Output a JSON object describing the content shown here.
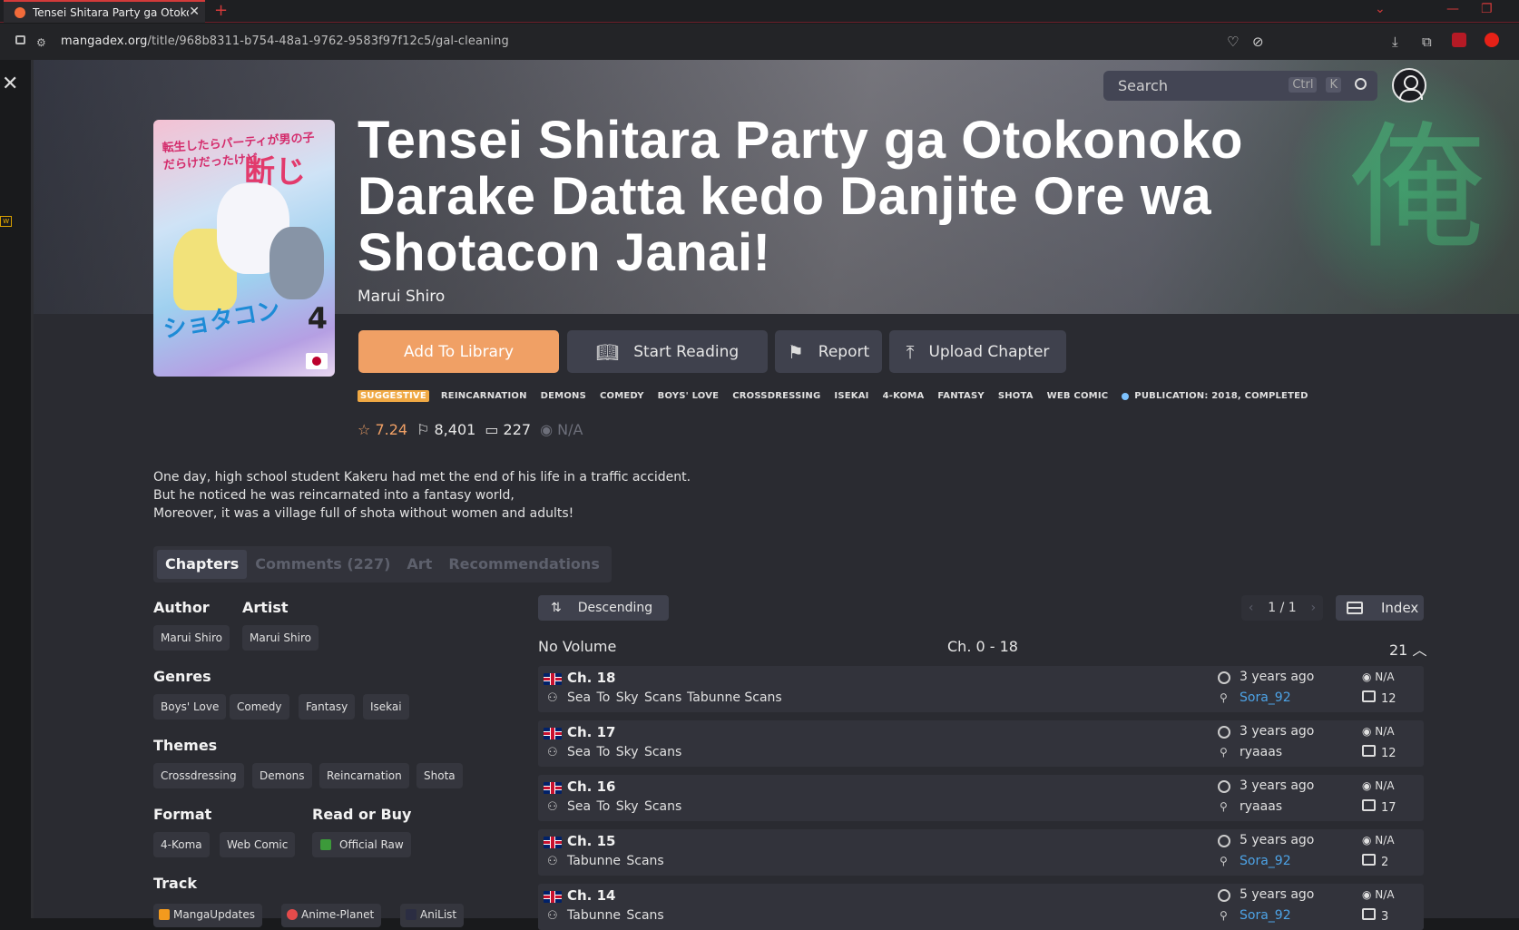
{
  "browser": {
    "tab_title": "Tensei Shitara Party ga Otokonoko",
    "url_host": "mangadex.org",
    "url_path": "/title/968b8311-b754-48a1-9762-9583f97f12c5/gal-cleaning"
  },
  "header": {
    "search_placeholder": "Search",
    "kbd_ctrl": "Ctrl",
    "kbd_k": "K"
  },
  "manga": {
    "title": "Tensei Shitara Party ga Otokonoko Darake Datta kedo Danjite Ore wa Shotacon Janai!",
    "author": "Marui Shiro",
    "buttons": {
      "add": "Add To Library",
      "start": "Start Reading",
      "report": "Report",
      "upload": "Upload Chapter"
    },
    "tags": {
      "suggestive": "SUGGESTIVE",
      "list": [
        "REINCARNATION",
        "DEMONS",
        "COMEDY",
        "BOYS' LOVE",
        "CROSSDRESSING",
        "ISEKAI",
        "4-KOMA",
        "FANTASY",
        "SHOTA",
        "WEB COMIC"
      ],
      "publication": "PUBLICATION: 2018, COMPLETED"
    },
    "stats": {
      "rating": "7.24",
      "follows": "8,401",
      "comments": "227",
      "views": "N/A"
    },
    "description": [
      "One day, high school student Kakeru had met the end of his life in a traffic accident.",
      "But he noticed he was reincarnated into a fantasy world,",
      "Moreover, it was a village full of shota without women and adults!"
    ]
  },
  "tabs": {
    "chapters": "Chapters",
    "comments": "Comments (227)",
    "art": "Art",
    "recommendations": "Recommendations"
  },
  "info": {
    "author_h": "Author",
    "artist_h": "Artist",
    "author": "Marui Shiro",
    "artist": "Marui Shiro",
    "genres_h": "Genres",
    "genres": [
      "Boys' Love",
      "Comedy",
      "Fantasy",
      "Isekai"
    ],
    "themes_h": "Themes",
    "themes": [
      "Crossdressing",
      "Demons",
      "Reincarnation",
      "Shota"
    ],
    "format_h": "Format",
    "format": [
      "4-Koma",
      "Web Comic"
    ],
    "buy_h": "Read or Buy",
    "buy": "Official Raw",
    "track_h": "Track",
    "track": [
      "MangaUpdates",
      "Anime-Planet",
      "AniList"
    ]
  },
  "chapters": {
    "sort": "Descending",
    "page": "1 / 1",
    "index": "Index",
    "volume": "No Volume",
    "range": "Ch. 0 - 18",
    "count": "21",
    "rows": [
      {
        "ch": "Ch. 18",
        "groups": "Sea To Sky Scans",
        "group2": "Tabunne Scans",
        "time": "3 years ago",
        "user": "Sora_92",
        "views": "N/A",
        "comments": "12"
      },
      {
        "ch": "Ch. 17",
        "groups": "Sea To Sky Scans",
        "group2": "",
        "time": "3 years ago",
        "user": "ryaaas",
        "views": "N/A",
        "comments": "12"
      },
      {
        "ch": "Ch. 16",
        "groups": "Sea To Sky Scans",
        "group2": "",
        "time": "3 years ago",
        "user": "ryaaas",
        "views": "N/A",
        "comments": "17"
      },
      {
        "ch": "Ch. 15",
        "groups": "Tabunne Scans",
        "group2": "",
        "time": "5 years ago",
        "user": "Sora_92",
        "views": "N/A",
        "comments": "2"
      },
      {
        "ch": "Ch. 14",
        "groups": "Tabunne Scans",
        "group2": "",
        "time": "5 years ago",
        "user": "Sora_92",
        "views": "N/A",
        "comments": "3"
      }
    ]
  }
}
